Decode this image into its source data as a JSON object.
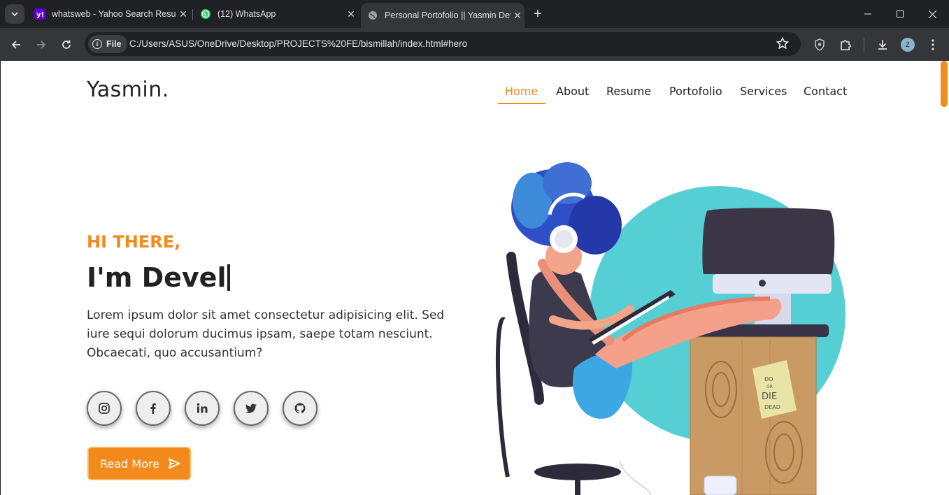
{
  "browser": {
    "tabs": [
      {
        "title": "whatsweb - Yahoo Search Results",
        "favicon": "yahoo-icon"
      },
      {
        "title": "(12) WhatsApp",
        "favicon": "whatsapp-icon"
      },
      {
        "title": "Personal Portofolio || Yasmin Dev",
        "favicon": "globe-icon",
        "active": true
      }
    ],
    "address": {
      "scheme_chip": "File",
      "url": "C:/Users/ASUS/OneDrive/Desktop/PROJECTS%20FE/bismillah/index.html#hero"
    },
    "profile_initial": "Z",
    "colors": {
      "frame": "#202124",
      "toolbar": "#35363a"
    }
  },
  "page": {
    "logo": "Yasmin.",
    "nav": {
      "items": [
        "Home",
        "About",
        "Resume",
        "Portofolio",
        "Services",
        "Contact"
      ],
      "active": "Home"
    },
    "hero": {
      "greeting": "HI THERE,",
      "headline": "I'm Devel",
      "bio": "Lorem ipsum dolor sit amet consectetur adipisicing elit. Sed iure sequi dolorum ducimus ipsam, saepe totam nesciunt. Obcaecati, quo accusantium?",
      "social": [
        "instagram-icon",
        "facebook-icon",
        "linkedin-icon",
        "twitter-icon",
        "github-icon"
      ],
      "cta": "Read More",
      "sticky_note": [
        "DO",
        "OR",
        "DIE",
        "DEAD"
      ]
    },
    "colors": {
      "accent": "#f28a1c",
      "text": "#222222",
      "circle": "#55cfd4"
    }
  }
}
